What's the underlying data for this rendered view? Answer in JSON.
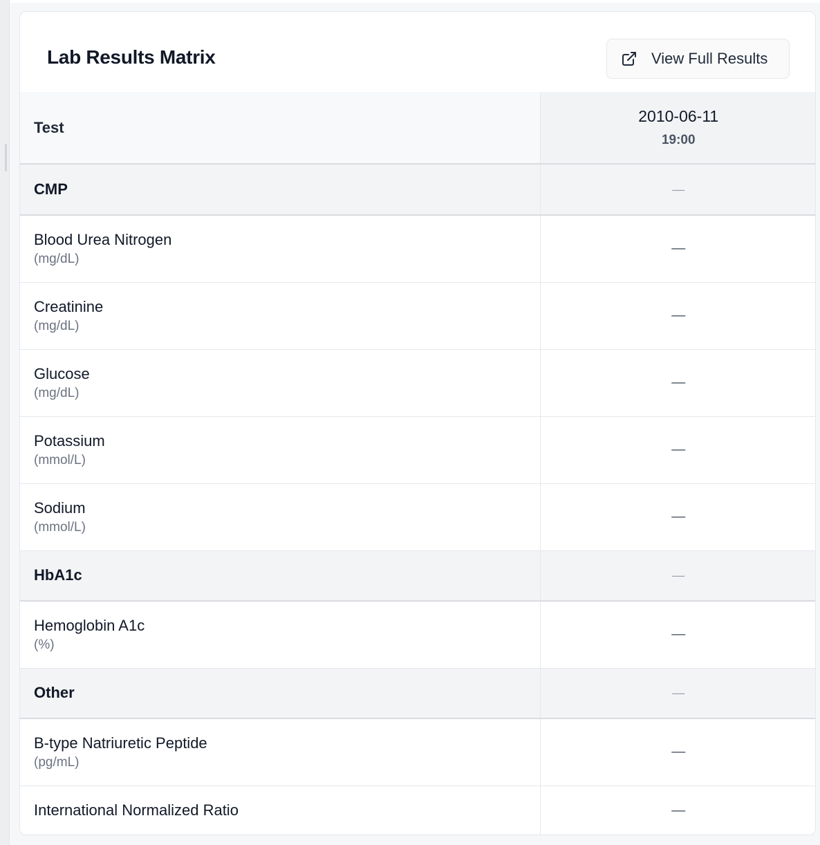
{
  "header": {
    "title": "Lab Results Matrix",
    "view_button_label": "View Full Results",
    "view_button_icon": "external-link-icon"
  },
  "table": {
    "test_column_label": "Test",
    "date_column": {
      "date": "2010-06-11",
      "time": "19:00"
    },
    "empty_value": "—",
    "groups": [
      {
        "name": "CMP",
        "value": "—",
        "tests": [
          {
            "name": "Blood Urea Nitrogen",
            "unit": "(mg/dL)",
            "value": "—"
          },
          {
            "name": "Creatinine",
            "unit": "(mg/dL)",
            "value": "—"
          },
          {
            "name": "Glucose",
            "unit": "(mg/dL)",
            "value": "—"
          },
          {
            "name": "Potassium",
            "unit": "(mmol/L)",
            "value": "—"
          },
          {
            "name": "Sodium",
            "unit": "(mmol/L)",
            "value": "—"
          }
        ]
      },
      {
        "name": "HbA1c",
        "value": "—",
        "tests": [
          {
            "name": "Hemoglobin A1c",
            "unit": "(%)",
            "value": "—"
          }
        ]
      },
      {
        "name": "Other",
        "value": "—",
        "tests": [
          {
            "name": "B-type Natriuretic Peptide",
            "unit": "(pg/mL)",
            "value": "—"
          },
          {
            "name": "International Normalized Ratio",
            "unit": "",
            "value": "—"
          }
        ]
      }
    ]
  }
}
